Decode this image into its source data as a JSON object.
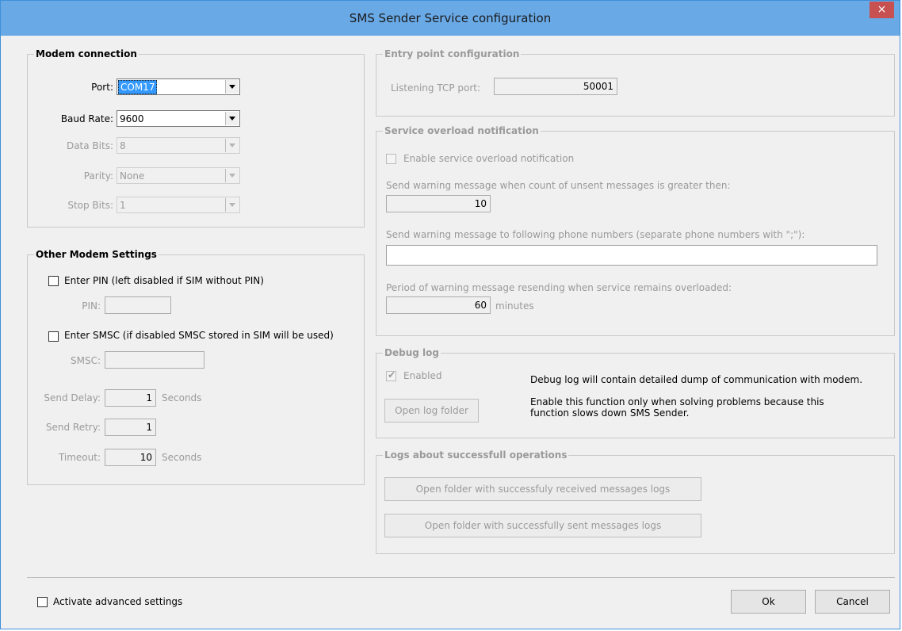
{
  "window": {
    "title": "SMS Sender Service configuration",
    "close_glyph": "×"
  },
  "modem": {
    "title": "Modem connection",
    "port_label": "Port:",
    "port_value": "COM17",
    "baud_label": "Baud Rate:",
    "baud_value": "9600",
    "databits_label": "Data Bits:",
    "databits_value": "8",
    "parity_label": "Parity:",
    "parity_value": "None",
    "stopbits_label": "Stop Bits:",
    "stopbits_value": "1"
  },
  "other": {
    "title": "Other Modem Settings",
    "pin_check_label": "Enter PIN (left disabled if SIM without PIN)",
    "pin_label": "PIN:",
    "pin_value": "",
    "smsc_check_label": "Enter SMSC (if disabled SMSC stored in SIM will be used)",
    "smsc_label": "SMSC:",
    "smsc_value": "",
    "delay_label": "Send Delay:",
    "delay_value": "1",
    "delay_unit": "Seconds",
    "retry_label": "Send Retry:",
    "retry_value": "1",
    "timeout_label": "Timeout:",
    "timeout_value": "10",
    "timeout_unit": "Seconds"
  },
  "entry": {
    "title": "Entry point configuration",
    "tcp_label": "Listening TCP port:",
    "tcp_value": "50001"
  },
  "overload": {
    "title": "Service overload notification",
    "enable_label": "Enable service overload notification",
    "count_label": "Send warning message when count of unsent messages is greater then:",
    "count_value": "10",
    "phones_label": "Send warning message to following phone numbers (separate phone numbers with \";\"):",
    "phones_value": "",
    "period_label": "Period of warning message resending when service remains overloaded:",
    "period_value": "60",
    "period_unit": "minutes"
  },
  "debug": {
    "title": "Debug log",
    "enabled_label": "Enabled",
    "desc1": "Debug log will contain detailed dump of communication with modem.",
    "desc2a": "Enable this function only when solving problems because this",
    "desc2b": "function slows down SMS Sender.",
    "open_button": "Open log folder"
  },
  "logs": {
    "title": "Logs about successfull operations",
    "received_button": "Open folder with successfuly received messages logs",
    "sent_button": "Open folder with successfully sent messages logs"
  },
  "footer": {
    "advanced_label": "Activate advanced settings",
    "ok": "Ok",
    "cancel": "Cancel"
  },
  "colors": {
    "titlebar": "#69a9e6",
    "close": "#c75050",
    "selection": "#3399ff",
    "window_bg": "#f0f0f0"
  }
}
